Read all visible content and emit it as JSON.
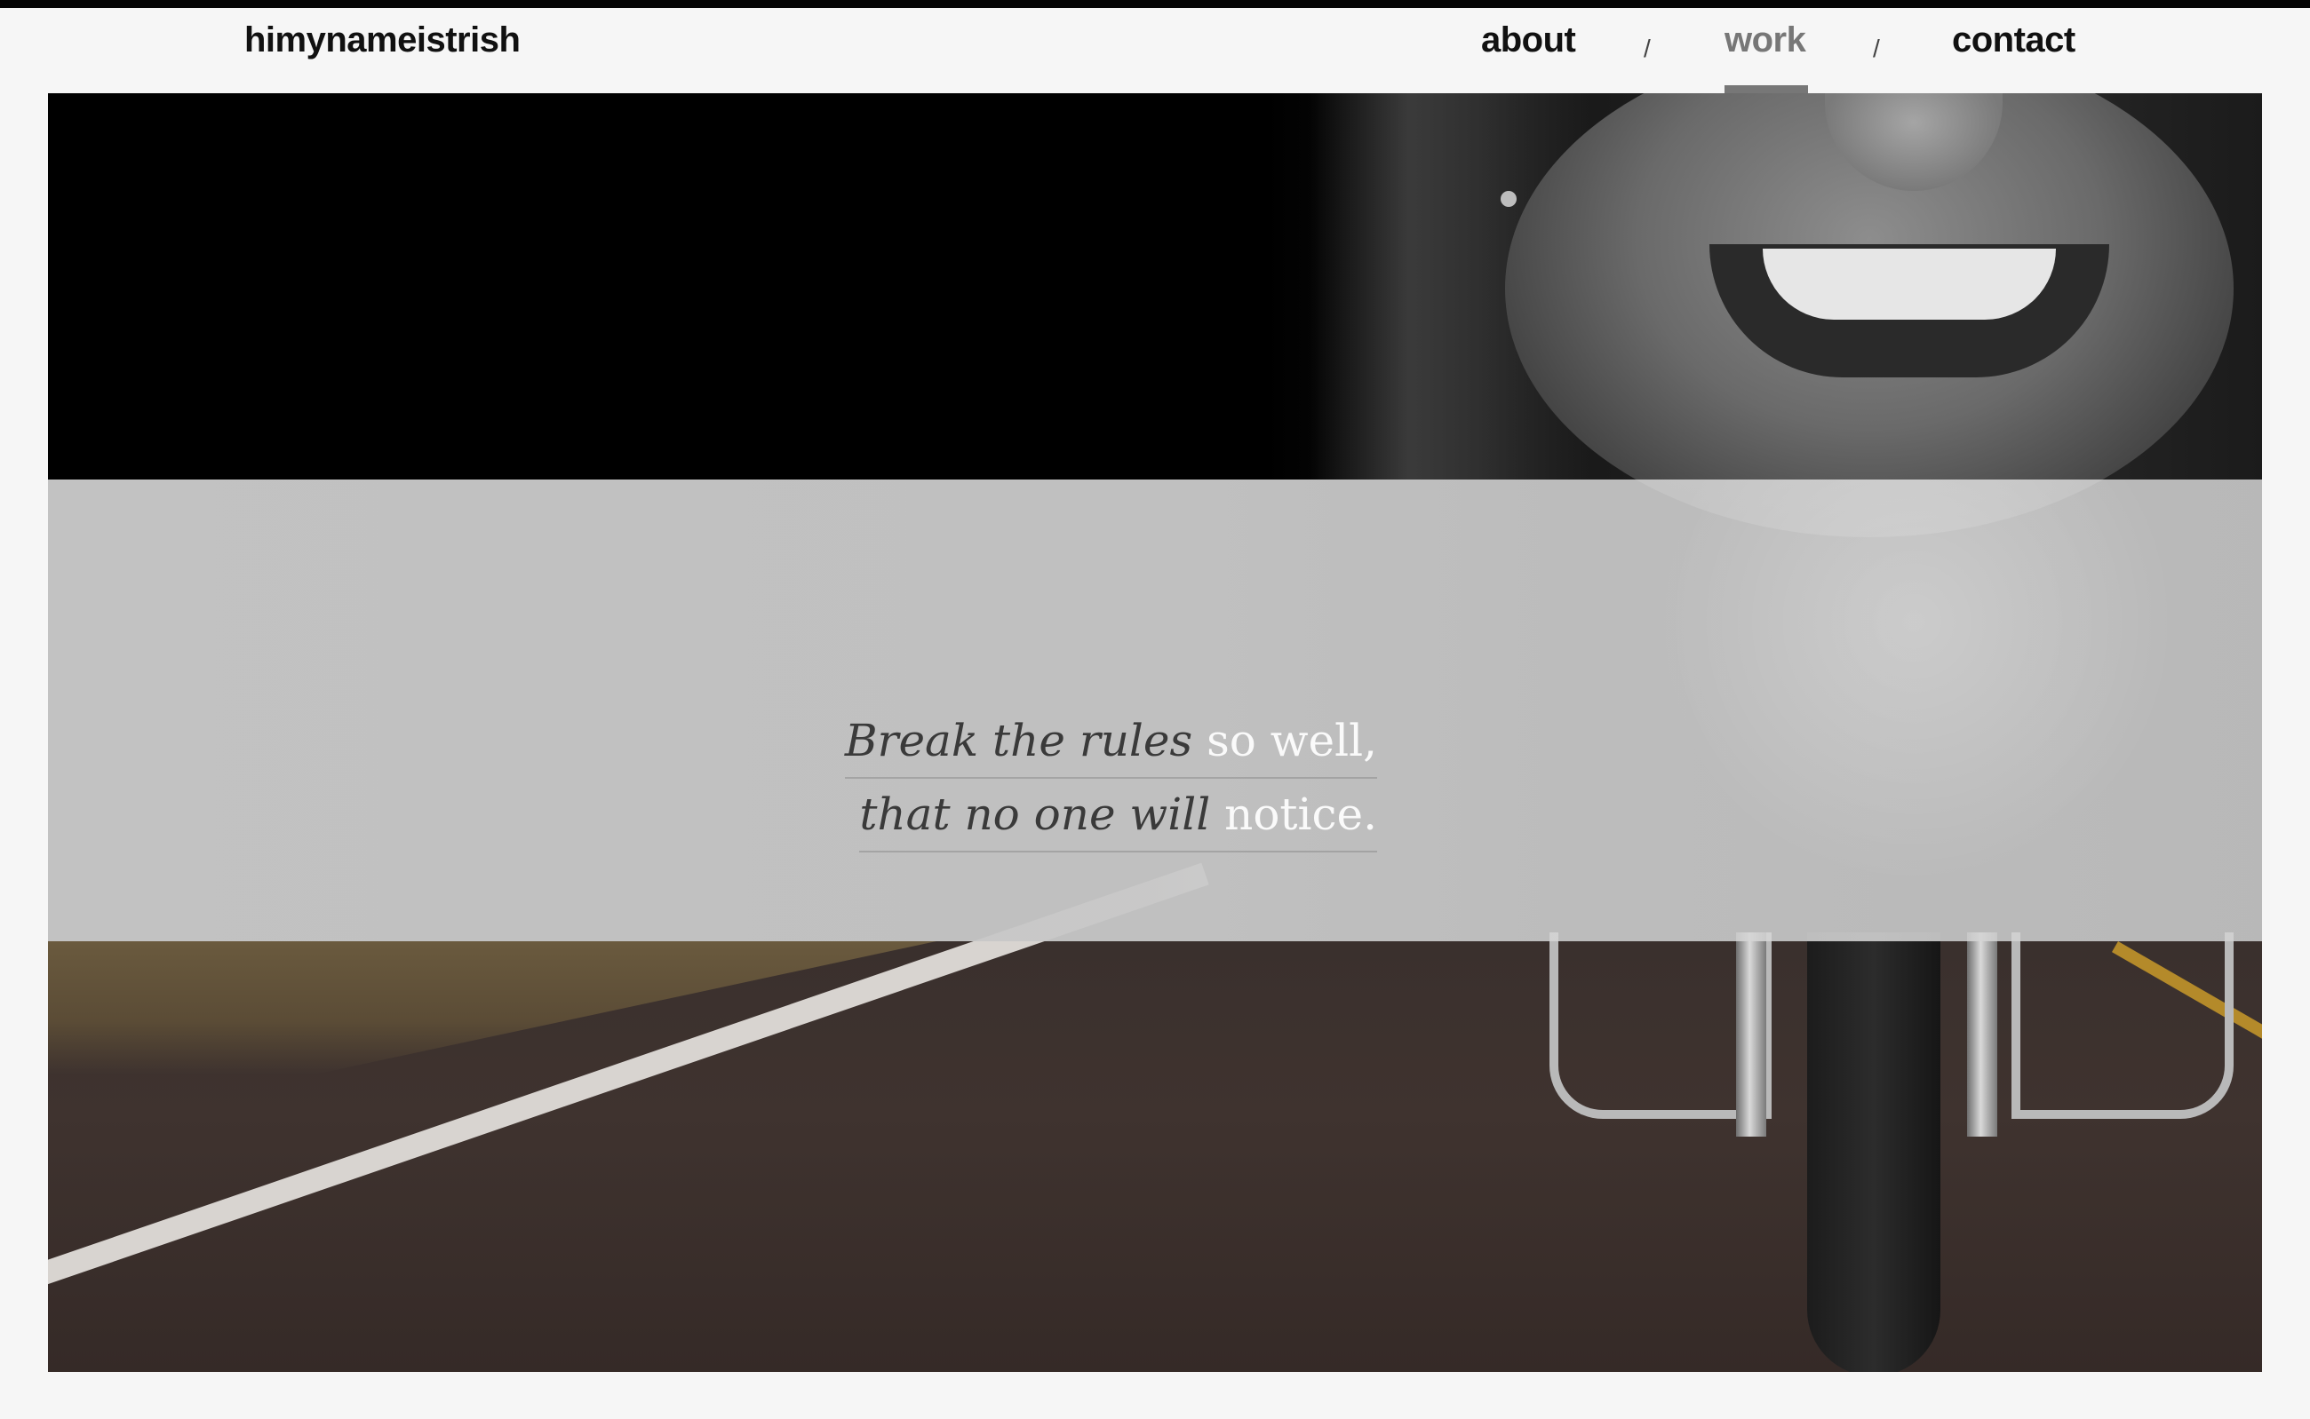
{
  "header": {
    "logo": "himynameistrish",
    "nav": {
      "about": "about",
      "work": "work",
      "contact": "contact",
      "separator": "/"
    }
  },
  "hero": {
    "tagline": {
      "line1_italic": "Break the rules",
      "line1_plain": "so well,",
      "line2_italic": "that no one will",
      "line2_plain": "notice."
    }
  }
}
